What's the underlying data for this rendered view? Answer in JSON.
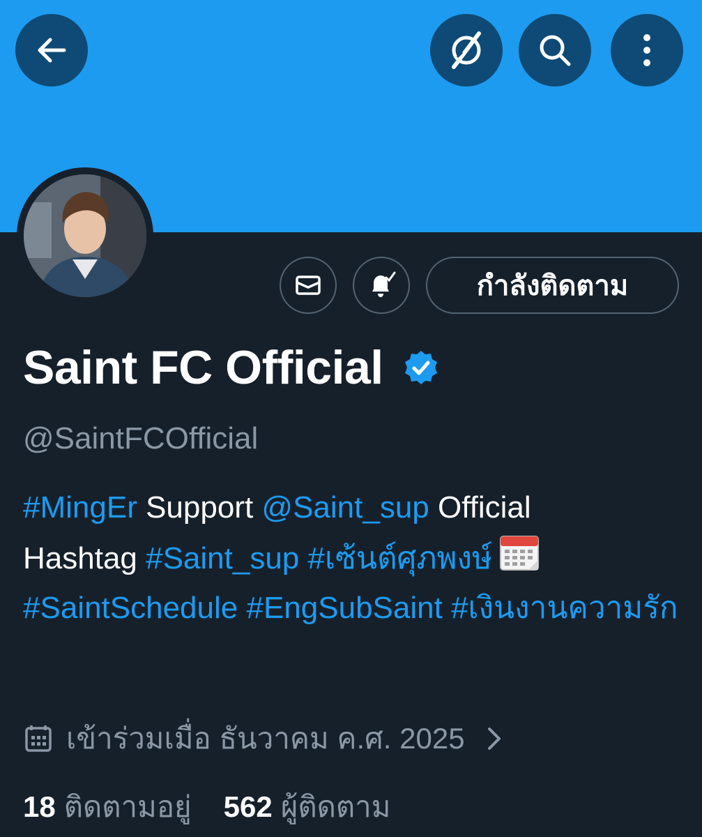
{
  "header": {
    "back_icon": "arrow-left-icon",
    "grok_icon": "grok-icon",
    "search_icon": "search-icon",
    "more_icon": "more-vertical-icon",
    "banner_color": "#1d9bf0"
  },
  "actions": {
    "message_icon": "envelope-icon",
    "notify_icon": "bell-check-icon",
    "follow_label": "กำลังติดตาม"
  },
  "profile": {
    "name": "Saint FC Official",
    "verified": true,
    "handle": "@SaintFCOfficial",
    "bio": {
      "tag_minger": "#MingEr",
      "support": " Support ",
      "mention": "@Saint_sup",
      "official": " Official",
      "hashtag_word": "Hashtag ",
      "tag_saint_sup": "#Saint_sup",
      "tag_thai_name": "#เซ้นต์ศุภพงษ์",
      "tag_schedule": "#SaintSchedule",
      "tag_engsub": "#EngSubSaint",
      "tag_money_love": "#เงินงานความรัก",
      "emoji": "calendar-emoji"
    },
    "joined": "เข้าร่วมเมื่อ ธันวาคม ค.ศ. 2025",
    "following_count": "18",
    "following_label": "ติดตามอยู่",
    "followers_count": "562",
    "followers_label": "ผู้ติดตาม"
  },
  "colors": {
    "accent": "#1d9bf0",
    "background": "#16202b",
    "secondary_text": "#8b98a5"
  }
}
